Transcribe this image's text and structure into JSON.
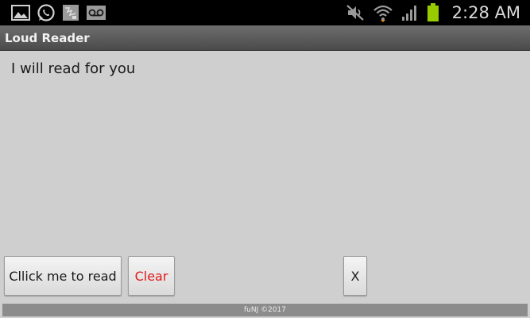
{
  "status_bar": {
    "time": "2:28 AM",
    "left_icons": [
      "gallery-icon",
      "whatsapp-icon",
      "image-broken-icon",
      "voicemail-icon"
    ],
    "right_icons": [
      "mute-icon",
      "wifi-icon",
      "signal-icon",
      "battery-icon"
    ],
    "battery_color": "#99cc00"
  },
  "app": {
    "title": "Loud Reader"
  },
  "main": {
    "text": "I will read for you"
  },
  "buttons": {
    "read_label": "Cllick me to read",
    "clear_label": "Clear",
    "close_label": "X"
  },
  "footer": {
    "text": "fuNJ ©2017"
  },
  "colors": {
    "clear_text": "#e01818",
    "background": "#cfcfcf"
  }
}
